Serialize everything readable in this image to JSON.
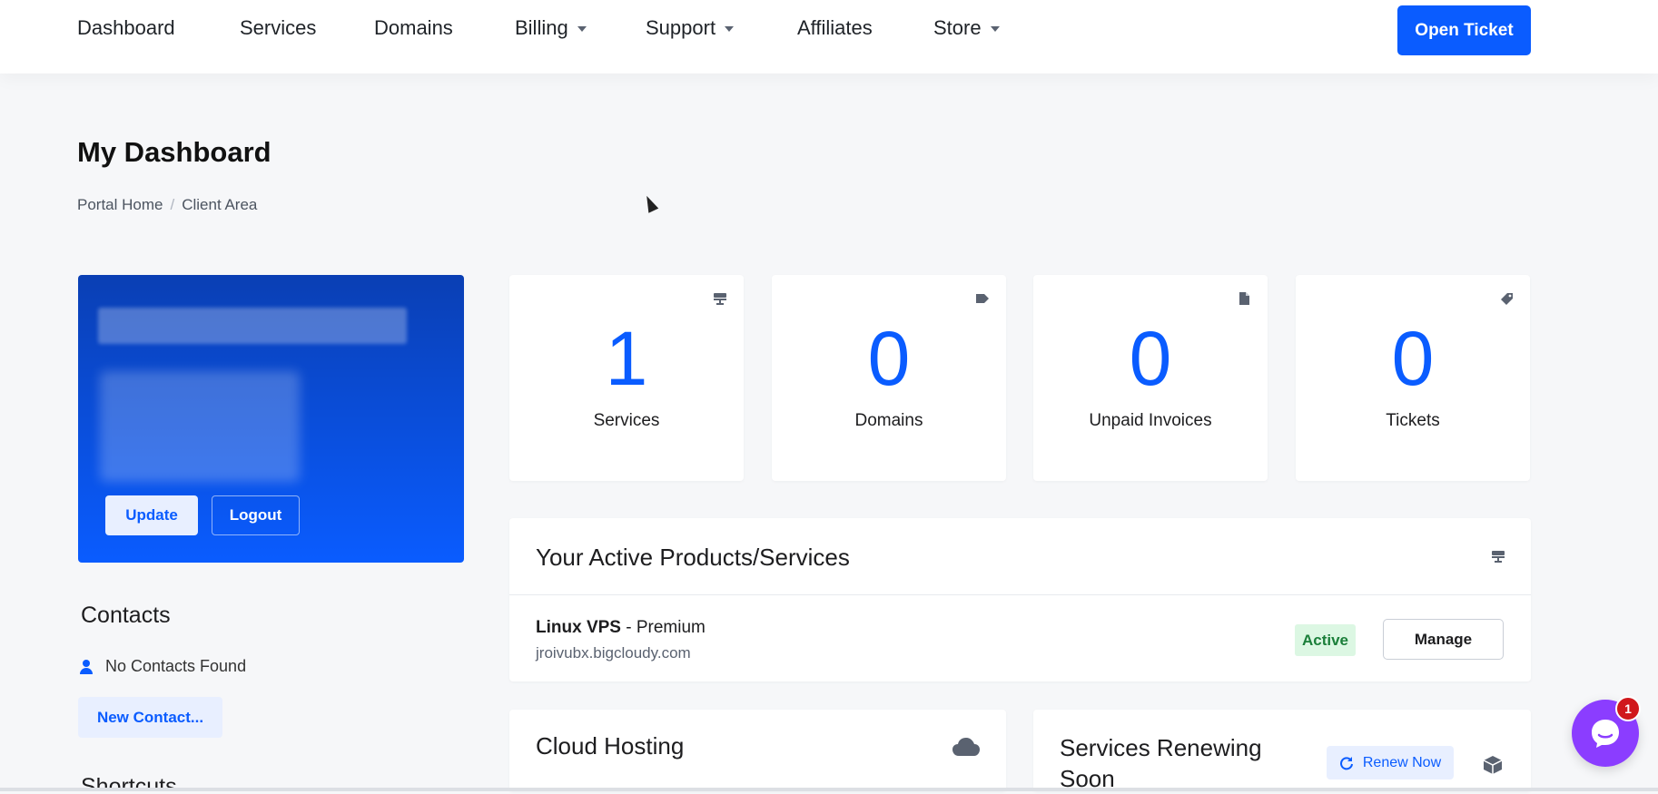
{
  "nav": {
    "items": [
      {
        "label": "Dashboard",
        "dropdown": false
      },
      {
        "label": "Services",
        "dropdown": false
      },
      {
        "label": "Domains",
        "dropdown": false
      },
      {
        "label": "Billing",
        "dropdown": true
      },
      {
        "label": "Support",
        "dropdown": true
      },
      {
        "label": "Affiliates",
        "dropdown": false
      },
      {
        "label": "Store",
        "dropdown": true
      }
    ],
    "open_ticket_label": "Open Ticket"
  },
  "page": {
    "title": "My Dashboard",
    "breadcrumb": [
      "Portal Home",
      "Client Area"
    ]
  },
  "profile": {
    "update_label": "Update",
    "logout_label": "Logout"
  },
  "contacts": {
    "title": "Contacts",
    "empty_text": "No Contacts Found",
    "new_contact_label": "New Contact..."
  },
  "shortcuts": {
    "title": "Shortcuts"
  },
  "stats": [
    {
      "value": "1",
      "label": "Services",
      "icon": "server-icon"
    },
    {
      "value": "0",
      "label": "Domains",
      "icon": "tag-icon"
    },
    {
      "value": "0",
      "label": "Unpaid Invoices",
      "icon": "file-icon"
    },
    {
      "value": "0",
      "label": "Tickets",
      "icon": "ticket-icon"
    }
  ],
  "active_services": {
    "title": "Your Active Products/Services",
    "items": [
      {
        "product": "Linux VPS",
        "plan": "Premium",
        "domain": "jroivubx.bigcloudy.com",
        "status": "Active",
        "manage_label": "Manage"
      }
    ]
  },
  "cloud_hosting": {
    "title": "Cloud Hosting"
  },
  "renewing": {
    "title_line1": "Services Renewing",
    "title_line2": "Soon",
    "renew_label": "Renew Now"
  },
  "chat": {
    "unread_count": "1"
  },
  "colors": {
    "primary": "#0a5cff",
    "active_badge_bg": "#dcf7e3",
    "chat": "#8b3dff"
  }
}
